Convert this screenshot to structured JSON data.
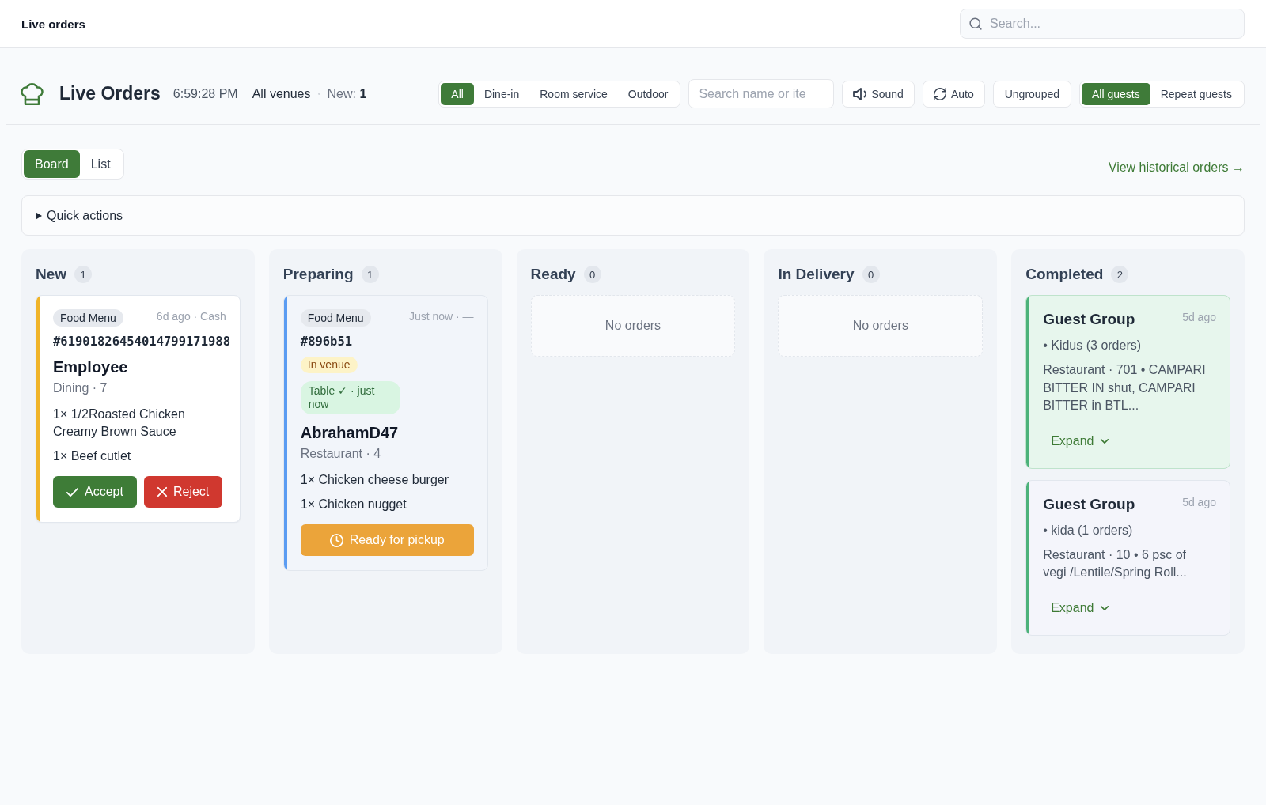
{
  "top_bar": {
    "title": "Live orders",
    "search": {
      "placeholder": "Search..."
    }
  },
  "header": {
    "title": "Live Orders",
    "time": "6:59:28 PM",
    "venue": "All venues",
    "new_orders": "New: **1**",
    "service_filters": [
      {
        "label": "All",
        "selected": true
      },
      {
        "label": "Dine-in",
        "selected": false
      },
      {
        "label": "Room service",
        "selected": false
      },
      {
        "label": "Outdoor",
        "selected": false
      }
    ],
    "search": {
      "placeholder": "Search name or ite"
    },
    "buttons": [
      {
        "kind": "sound",
        "label": "Sound"
      },
      {
        "kind": "auto",
        "label": "Auto"
      },
      {
        "kind": "plain",
        "label": "Ungrouped"
      }
    ],
    "guest_filters": [
      {
        "label": "All guests",
        "selected": true
      },
      {
        "label": "Repeat guests",
        "selected": false
      }
    ]
  },
  "views": [
    {
      "label": "Board",
      "selected": true
    },
    {
      "label": "List",
      "selected": false
    }
  ],
  "history_link": "View historical orders →",
  "quick_actions": {
    "label": "Quick actions",
    "expanded": false
  },
  "columns": [
    {
      "title": "New",
      "count": "1",
      "cards": [
        {
          "kind": "new",
          "color": "#f0b429",
          "tag": "Food Menu",
          "meta": "6d ago · Cash",
          "number": "#61901826454014799171988",
          "customer": "Employee",
          "location": "Dining · 7",
          "items": [
            "1× 1/2Roasted Chicken Creamy Brown Sauce",
            "1× Beef cutlet"
          ],
          "actions": [
            {
              "kind": "accept",
              "label": "Accept"
            },
            {
              "kind": "reject",
              "label": "Reject"
            }
          ]
        }
      ]
    },
    {
      "title": "Preparing",
      "count": "1",
      "cards": [
        {
          "kind": "preparing",
          "color": "#5b9cf2",
          "tag": "Food Menu",
          "meta": "Just now · —",
          "number": "#896b51",
          "badges": [
            {
              "kind": "warning",
              "label": "In venue"
            },
            {
              "kind": "success",
              "label": "Table ✓ · just now"
            }
          ],
          "customer": "AbrahamD47",
          "location": "Restaurant · 4",
          "items": [
            "1× Chicken cheese burger",
            "1× Chicken nugget"
          ],
          "actions": [
            {
              "kind": "ready",
              "label": "Ready for pickup"
            }
          ]
        }
      ]
    },
    {
      "title": "Ready",
      "count": "0",
      "empty_text": "No orders"
    },
    {
      "title": "In Delivery",
      "count": "0",
      "empty_text": "No orders"
    },
    {
      "title": "Completed",
      "count": "2",
      "cards": [
        {
          "kind": "group",
          "color": "#4cb27a",
          "highlighted": true,
          "title": "Guest Group",
          "time": "5d ago",
          "guests": "• Kidus (3 orders)",
          "summary": "Restaurant · 701 • CAMPARI BITTER IN shut, CAMPARI BITTER in BTL...",
          "expand": {
            "label": "Expand",
            "expanded": false
          }
        },
        {
          "kind": "group",
          "color": "#4cb27a",
          "highlighted": false,
          "title": "Guest Group",
          "time": "5d ago",
          "guests": "• kida (1 orders)",
          "summary": "Restaurant · 10 • 6 psc of vegi /Lentile/Spring Roll...",
          "expand": {
            "label": "Expand",
            "expanded": false
          }
        }
      ]
    }
  ]
}
